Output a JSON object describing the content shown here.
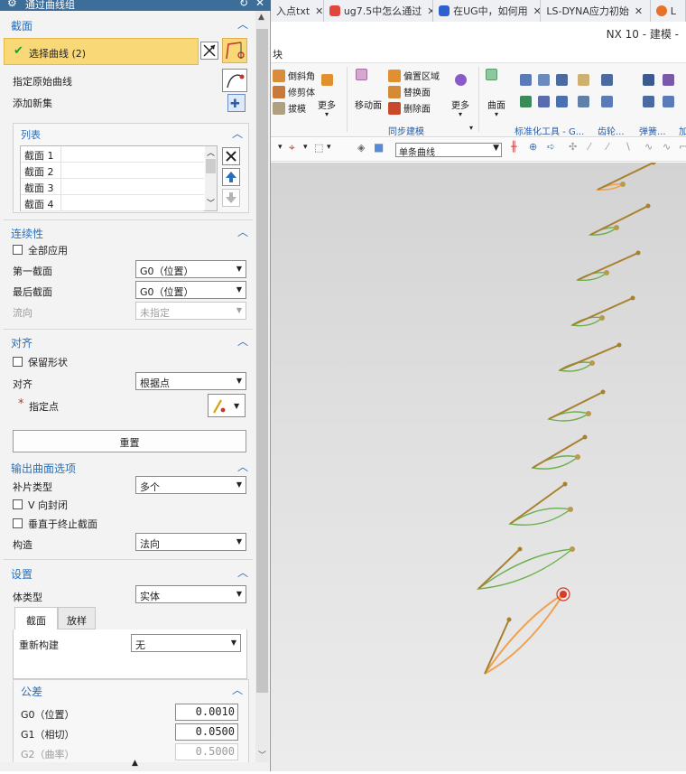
{
  "dialog": {
    "title": "通过曲线组",
    "section_sections": "截面",
    "select_curve_label": "选择曲线 (2)",
    "specify_original_curve": "指定原始曲线",
    "add_new_set": "添加新集",
    "list_header": "列表",
    "list_items": [
      "截面 1",
      "截面 2",
      "截面 3",
      "截面 4"
    ],
    "continuity": {
      "header": "连续性",
      "apply_all": "全部应用",
      "first_section_label": "第一截面",
      "first_section_value": "G0（位置）",
      "last_section_label": "最后截面",
      "last_section_value": "G0（位置）",
      "flow_dir_label": "流向",
      "flow_dir_value": "未指定"
    },
    "alignment": {
      "header": "对齐",
      "keep_shape": "保留形状",
      "align_label": "对齐",
      "align_value": "根据点",
      "specify_point": "指定点",
      "required_mark": "*",
      "reset": "重置"
    },
    "output": {
      "header": "输出曲面选项",
      "patch_type_label": "补片类型",
      "patch_type_value": "多个",
      "v_closed": "V 向封闭",
      "perp_end": "垂直于终止截面",
      "construct_label": "构造",
      "construct_value": "法向"
    },
    "settings": {
      "header": "设置",
      "body_type_label": "体类型",
      "body_type_value": "实体",
      "tabs": [
        "截面",
        "放样"
      ],
      "rebuild_label": "重新构建",
      "rebuild_value": "无"
    },
    "tolerance": {
      "header": "公差",
      "g0_label": "G0（位置）",
      "g0_value": "0.0010",
      "g1_label": "G1（相切）",
      "g1_value": "0.0500",
      "g2_label": "G2（曲率）",
      "g2_value": "0.5000"
    }
  },
  "browser": {
    "tabs": [
      {
        "label": "入点txt",
        "color": "#4a8cd6"
      },
      {
        "label": "ug7.5中怎么通过",
        "color": "#e2453c"
      },
      {
        "label": "在UG中，如何用",
        "color": "#2f5fd1"
      },
      {
        "label": "LS-DYNA应力初始",
        "color": "#ffffff"
      },
      {
        "label": "L",
        "color": "#e8712a"
      }
    ]
  },
  "nx": {
    "title": "NX 10 - 建模 -",
    "menu_fragment": "块",
    "ribbon": {
      "chamfer": "倒斜角",
      "trim_body": "修剪体",
      "draft": "拔模",
      "more1": "更多",
      "move_face": "移动面",
      "offset_region": "偏置区域",
      "replace_face": "替换面",
      "delete_face": "删除面",
      "more2": "更多",
      "curve_surface": "曲面",
      "group_sync": "同步建模",
      "group_std": "标准化工具 - G...",
      "group_gear": "齿轮...",
      "group_spring": "弹簧...",
      "group_add": "加"
    },
    "curve_rule": "单条曲线"
  },
  "colors": {
    "title_bar": "#3d6e99",
    "section_blue": "#2a6fb9",
    "selected_row": "#f9d877",
    "curve_green": "#6ab04c",
    "curve_orange": "#f0a050",
    "arrow_brown": "#a8802e",
    "viewport": "#dcdcdc"
  },
  "icons": [
    "gear-icon",
    "refresh-icon",
    "close-icon",
    "check-icon",
    "chevron-up-icon",
    "delete-x-icon",
    "move-up-icon",
    "move-down-icon",
    "curve-select-icon",
    "point-specify-icon"
  ]
}
